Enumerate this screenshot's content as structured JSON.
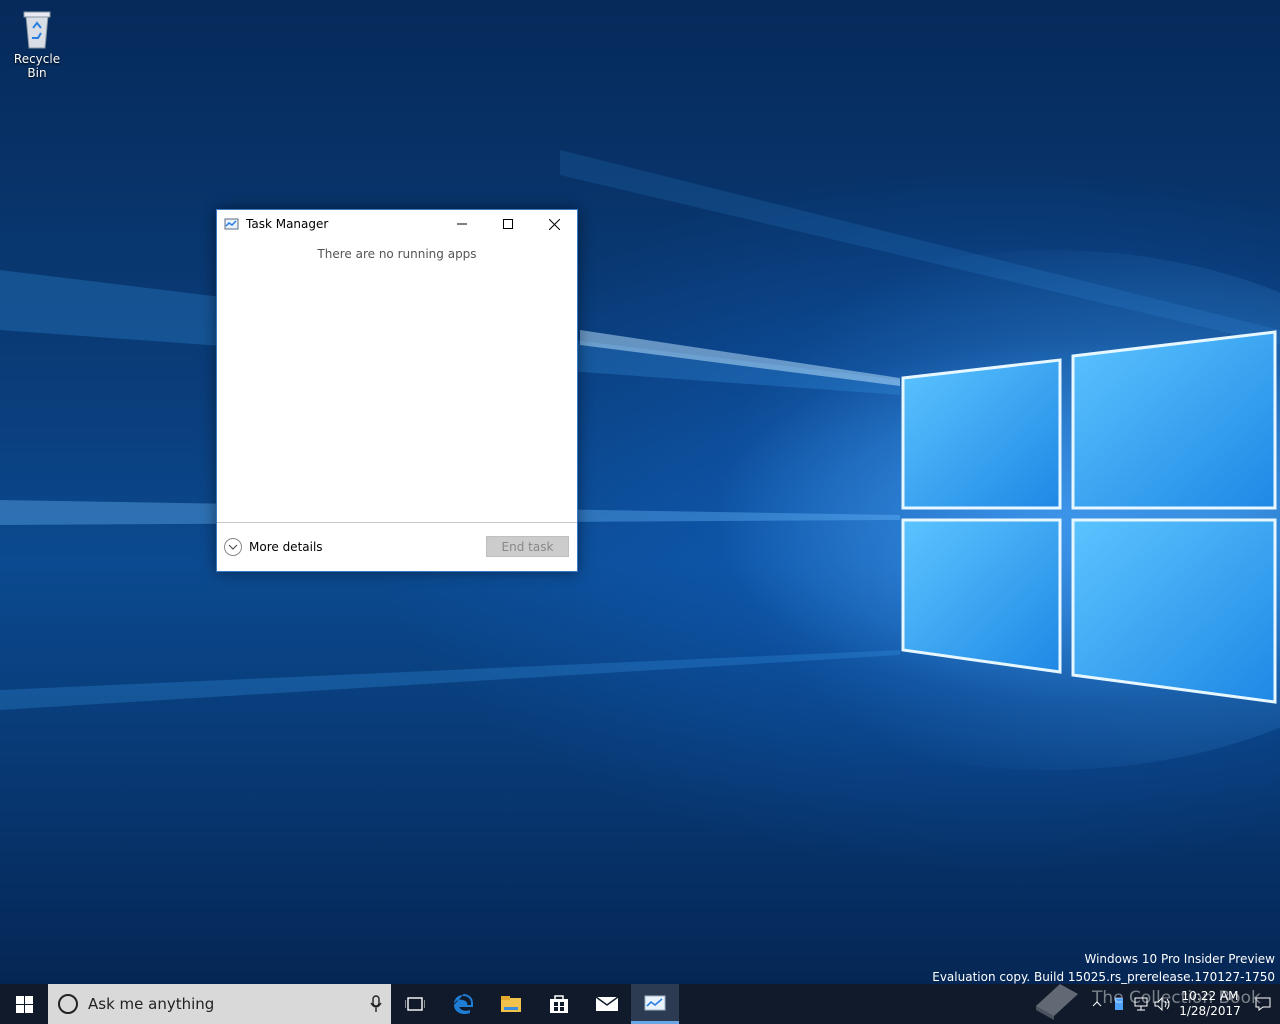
{
  "desktop": {
    "icons": [
      {
        "label": "Recycle Bin",
        "icon": "recycle-bin-icon"
      }
    ]
  },
  "window": {
    "title": "Task Manager",
    "empty_message": "There are no running apps",
    "more_details_label": "More details",
    "end_task_label": "End task"
  },
  "watermark": {
    "line1": "Windows 10 Pro Insider Preview",
    "line2": "Evaluation copy. Build 15025.rs_prerelease.170127-1750"
  },
  "taskbar": {
    "search_placeholder": "Ask me anything",
    "apps": [
      "task-view-icon",
      "edge-icon",
      "file-explorer-icon",
      "store-icon",
      "mail-icon",
      "task-manager-icon"
    ],
    "active_app": "task-manager-icon",
    "clock_time": "10:22 AM",
    "clock_date": "1/28/2017"
  },
  "overlay": {
    "brand_text": "The Collection Book"
  },
  "colors": {
    "accent": "#3b78c4",
    "taskbar_bg": "#101a2a",
    "search_bg": "#d9d9d9"
  }
}
